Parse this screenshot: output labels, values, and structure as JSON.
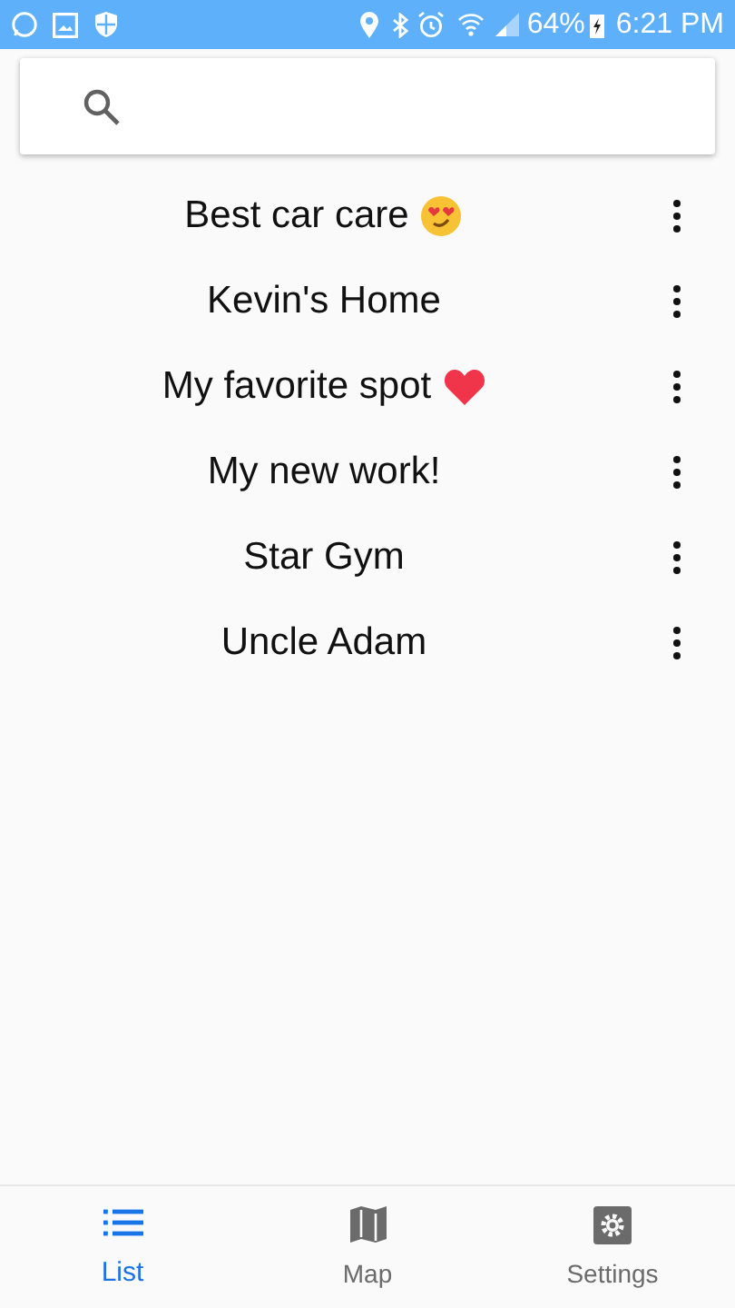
{
  "status_bar": {
    "battery": "64%",
    "time": "6:21 PM"
  },
  "places": [
    {
      "name": "Best car care",
      "kind": "love-face"
    },
    {
      "name": "Kevin's Home",
      "kind": "plain"
    },
    {
      "name": "My favorite spot",
      "kind": "heart"
    },
    {
      "name": "My new work!",
      "kind": "plain"
    },
    {
      "name": "Star Gym",
      "kind": "plain"
    },
    {
      "name": "Uncle Adam",
      "kind": "plain"
    }
  ],
  "tabs": [
    {
      "label": "List",
      "kind": "list",
      "selected": true
    },
    {
      "label": "Map",
      "kind": "map",
      "selected": false
    },
    {
      "label": "Settings",
      "kind": "settings",
      "selected": false
    }
  ]
}
